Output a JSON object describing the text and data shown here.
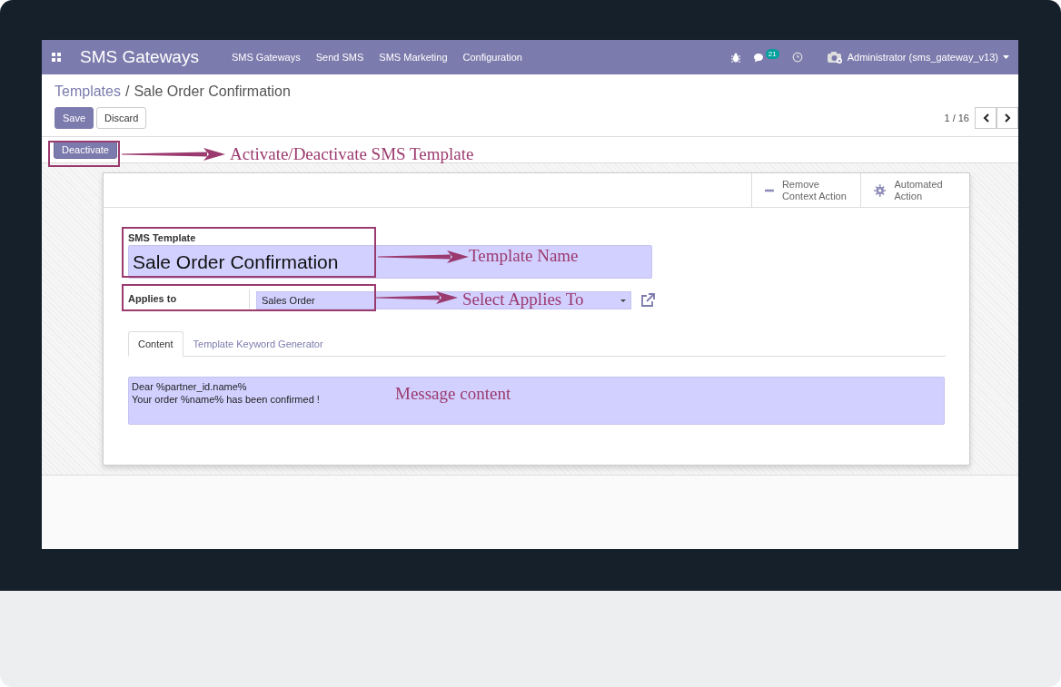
{
  "navbar": {
    "app_title": "SMS Gateways",
    "menu": [
      "SMS Gateways",
      "Send SMS",
      "SMS Marketing",
      "Configuration"
    ],
    "message_count": "21",
    "user": "Administrator (sms_gateway_v13)"
  },
  "breadcrumb": {
    "parent": "Templates",
    "separator": "/",
    "current": "Sale Order Confirmation"
  },
  "buttons": [
    {
      "label": "Save",
      "kind": "primary"
    },
    {
      "label": "Discard",
      "kind": "secondary"
    }
  ],
  "pager": {
    "text": "1 / 16"
  },
  "status_buttons": [
    "Deactivate"
  ],
  "smart_buttons": [
    {
      "label": "Remove Context Action",
      "kind": "minus"
    },
    {
      "label": "Automated Action",
      "kind": "gear"
    }
  ],
  "form": {
    "name_label": "SMS Template",
    "name": "Sale Order Confirmation",
    "applies_label": "Applies to",
    "applies_value": "Sales Order"
  },
  "tabs": [
    {
      "label": "Content",
      "selected": true
    },
    {
      "label": "Template Keyword Generator",
      "selected": false
    }
  ],
  "message": [
    "Dear %partner_id.name%",
    "Your order %name% has been confirmed !"
  ],
  "annotations": [
    {
      "text": "Activate/Deactivate SMS Template",
      "kind": "framed"
    },
    {
      "text": "Template Name",
      "kind": "framed"
    },
    {
      "text": "Select Applies To",
      "kind": "framed"
    },
    {
      "text": "Message content",
      "kind": "plain"
    }
  ]
}
